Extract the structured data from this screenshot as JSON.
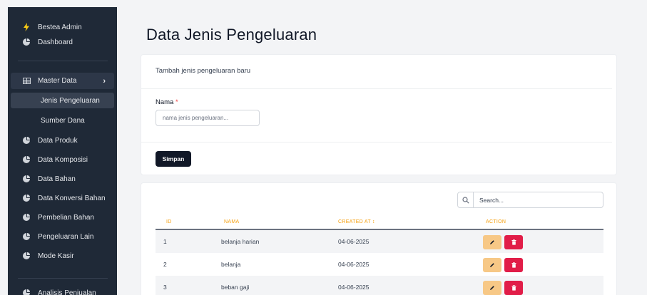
{
  "sidebar": {
    "brand": "Bestea Admin",
    "items": [
      {
        "label": "Dashboard"
      },
      {
        "label": "Master Data"
      },
      {
        "label": "Jenis Pengeluaran"
      },
      {
        "label": "Sumber Dana"
      },
      {
        "label": "Data Produk"
      },
      {
        "label": "Data Komposisi"
      },
      {
        "label": "Data Bahan"
      },
      {
        "label": "Data Konversi Bahan"
      },
      {
        "label": "Pembelian Bahan"
      },
      {
        "label": "Pengeluaran Lain"
      },
      {
        "label": "Mode Kasir"
      },
      {
        "label": "Analisis Penjualan"
      }
    ]
  },
  "page": {
    "title": "Data Jenis Pengeluaran"
  },
  "form": {
    "heading": "Tambah jenis pengeluaran baru",
    "name_label": "Nama",
    "required_mark": "*",
    "name_placeholder": "nama jenis pengeluaran...",
    "name_value": "",
    "submit_label": "Simpan"
  },
  "table": {
    "search_placeholder": "Search...",
    "columns": {
      "id": "ID",
      "nama": "NAMA",
      "created_at": "CREATED AT ↕",
      "action": "ACTION"
    },
    "rows": [
      {
        "id": "1",
        "nama": "belanja harian",
        "created_at": "04-06-2025"
      },
      {
        "id": "2",
        "nama": "belanja",
        "created_at": "04-06-2025"
      },
      {
        "id": "3",
        "nama": "beban gaji",
        "created_at": "04-06-2025"
      }
    ]
  },
  "colors": {
    "sidebar_bg": "#1f2937",
    "accent_header": "#f59e0b",
    "edit_button": "#f7c886",
    "delete_button": "#e11d48",
    "brand_icon": "#facc15"
  },
  "icons": {
    "brand": "lightning-icon",
    "nav": "pie-chart-icon",
    "master": "table-icon",
    "search": "search-icon",
    "edit": "pencil-icon",
    "delete": "trash-icon"
  }
}
